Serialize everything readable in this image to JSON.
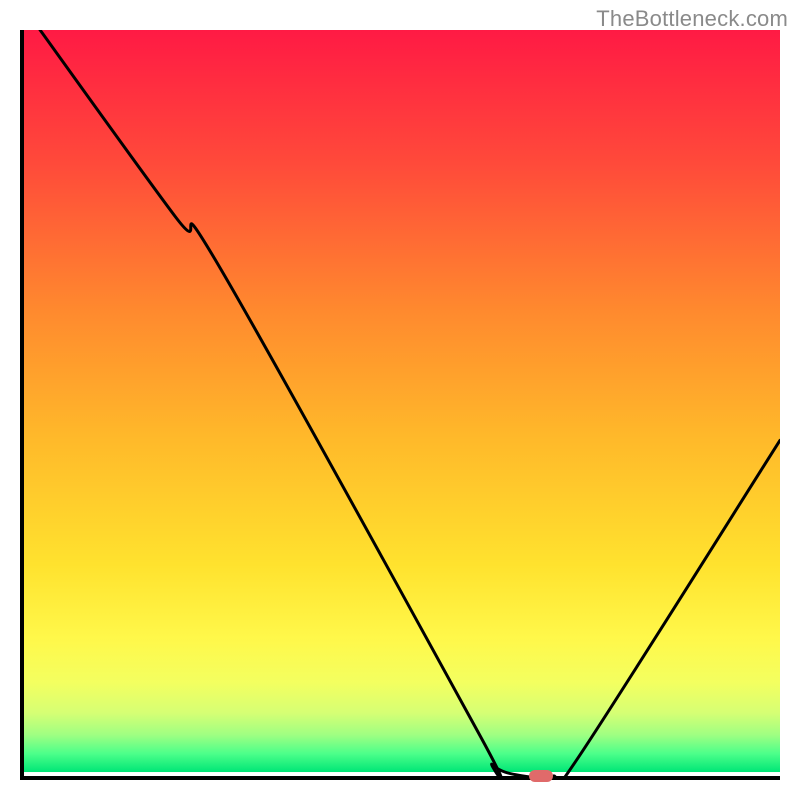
{
  "watermark": "TheBottleneck.com",
  "chart_data": {
    "type": "line",
    "title": "",
    "xlabel": "",
    "ylabel": "",
    "xlim": [
      0,
      100
    ],
    "ylim": [
      0,
      100
    ],
    "grid": false,
    "legend": false,
    "curve": [
      {
        "x": 0,
        "y": 103
      },
      {
        "x": 20,
        "y": 75
      },
      {
        "x": 26,
        "y": 68
      },
      {
        "x": 60,
        "y": 6
      },
      {
        "x": 62,
        "y": 1.5
      },
      {
        "x": 66,
        "y": 0
      },
      {
        "x": 70,
        "y": 0
      },
      {
        "x": 73,
        "y": 2
      },
      {
        "x": 100,
        "y": 45
      }
    ],
    "marker": {
      "x": 68,
      "y": 0.5
    },
    "gradient_stops": [
      {
        "offset": 0.0,
        "color": "#ff1a44"
      },
      {
        "offset": 0.18,
        "color": "#ff4a3a"
      },
      {
        "offset": 0.38,
        "color": "#ff8a2e"
      },
      {
        "offset": 0.55,
        "color": "#ffb92a"
      },
      {
        "offset": 0.72,
        "color": "#ffe22e"
      },
      {
        "offset": 0.82,
        "color": "#fff84a"
      },
      {
        "offset": 0.88,
        "color": "#f3ff60"
      },
      {
        "offset": 0.92,
        "color": "#d6ff74"
      },
      {
        "offset": 0.95,
        "color": "#9fff82"
      },
      {
        "offset": 0.975,
        "color": "#4dff8a"
      },
      {
        "offset": 1.0,
        "color": "#00e676"
      }
    ]
  }
}
